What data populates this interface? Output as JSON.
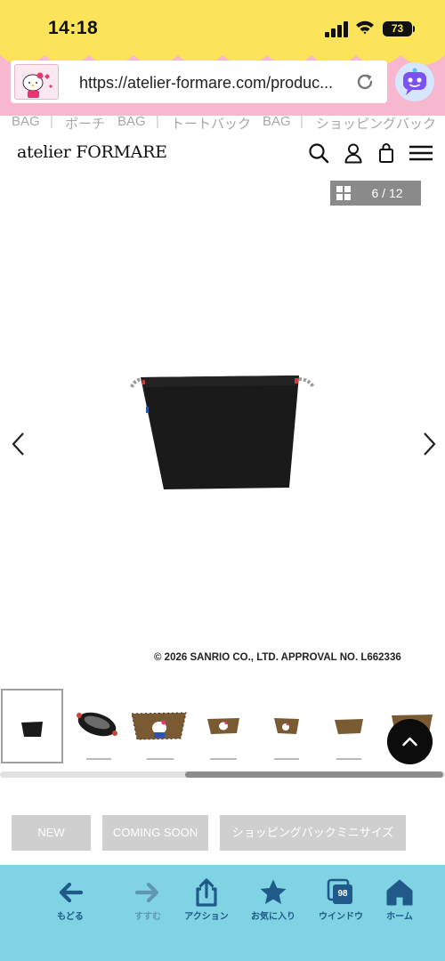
{
  "status_bar": {
    "time": "14:18",
    "battery": "73"
  },
  "browser": {
    "url": "https://atelier-formare.com/produc..."
  },
  "breadcrumb": [
    "BAG",
    "ポーチ",
    "BAG",
    "トートバック",
    "BAG",
    "ショッピングバック"
  ],
  "site": {
    "logo": "atelier FORMARE"
  },
  "gallery": {
    "counter": "6 / 12",
    "copyright": "© 2026 SANRIO CO., LTD. APPROVAL NO. L662336"
  },
  "tags": [
    "NEW",
    "COMING SOON",
    "ショッピングバックミニサイズ"
  ],
  "toolbar": {
    "back": "もどる",
    "forward": "すすむ",
    "action": "アクション",
    "bookmarks": "お気に入り",
    "windows": "ウインドウ",
    "window_count": "98",
    "home": "ホーム"
  },
  "colors": {
    "status_bar": "#fbe45a",
    "browser_bar": "#f6b7cf",
    "toolbar": "#7fd3e3",
    "toolbar_icon": "#1f5a8a",
    "bag": "#1a1a1a",
    "tag_bg": "#cfcfcf"
  }
}
